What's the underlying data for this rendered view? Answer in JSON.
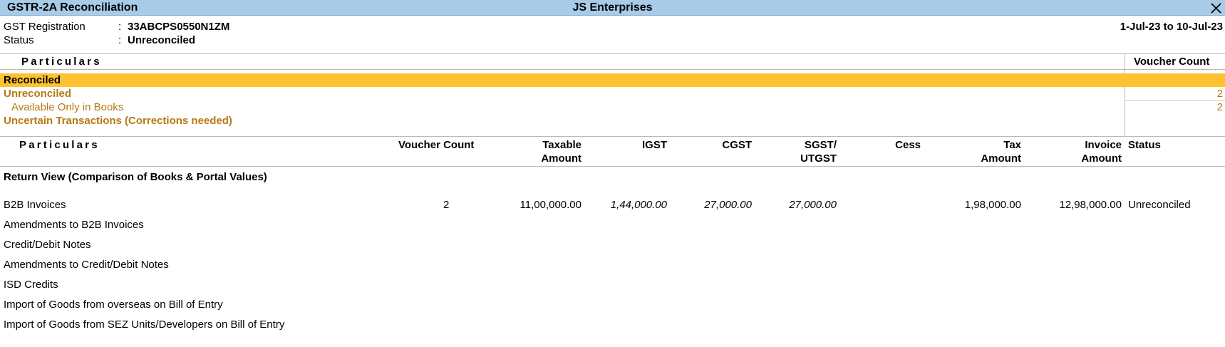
{
  "window": {
    "title": "GSTR-2A Reconciliation",
    "company": "JS Enterprises"
  },
  "info": {
    "gst_label": "GST Registration",
    "gst_value": "33ABCPS0550N1ZM",
    "status_label": "Status",
    "status_value": "Unreconciled",
    "colon": ":",
    "period": "1-Jul-23 to 10-Jul-23"
  },
  "summary": {
    "header_particulars": "Particulars",
    "header_voucher_count": "Voucher Count",
    "rows": [
      {
        "label": "Reconciled",
        "count": ""
      },
      {
        "label": "Unreconciled",
        "count": "2"
      },
      {
        "label": "Available Only in Books",
        "count": "2"
      },
      {
        "label": "Uncertain Transactions (Corrections needed)",
        "count": ""
      }
    ]
  },
  "detail": {
    "headers": {
      "particulars": "Particulars",
      "voucher_count": "Voucher Count",
      "taxable_1": "Taxable",
      "taxable_2": "Amount",
      "igst": "IGST",
      "cgst": "CGST",
      "sgst_1": "SGST/",
      "sgst_2": "UTGST",
      "cess": "Cess",
      "tax_1": "Tax",
      "tax_2": "Amount",
      "invoice_1": "Invoice",
      "invoice_2": "Amount",
      "status": "Status"
    },
    "section_title": "Return View (Comparison of Books & Portal Values)",
    "rows": [
      {
        "name": "B2B Invoices",
        "voucher_count": "2",
        "taxable": "11,00,000.00",
        "igst": "1,44,000.00",
        "cgst": "27,000.00",
        "sgst": "27,000.00",
        "cess": "",
        "tax": "1,98,000.00",
        "invoice": "12,98,000.00",
        "status": "Unreconciled"
      },
      {
        "name": "Amendments to B2B Invoices",
        "voucher_count": "",
        "taxable": "",
        "igst": "",
        "cgst": "",
        "sgst": "",
        "cess": "",
        "tax": "",
        "invoice": "",
        "status": ""
      },
      {
        "name": "Credit/Debit Notes",
        "voucher_count": "",
        "taxable": "",
        "igst": "",
        "cgst": "",
        "sgst": "",
        "cess": "",
        "tax": "",
        "invoice": "",
        "status": ""
      },
      {
        "name": "Amendments to Credit/Debit Notes",
        "voucher_count": "",
        "taxable": "",
        "igst": "",
        "cgst": "",
        "sgst": "",
        "cess": "",
        "tax": "",
        "invoice": "",
        "status": ""
      },
      {
        "name": "ISD Credits",
        "voucher_count": "",
        "taxable": "",
        "igst": "",
        "cgst": "",
        "sgst": "",
        "cess": "",
        "tax": "",
        "invoice": "",
        "status": ""
      },
      {
        "name": "Import of Goods from overseas on Bill of Entry",
        "voucher_count": "",
        "taxable": "",
        "igst": "",
        "cgst": "",
        "sgst": "",
        "cess": "",
        "tax": "",
        "invoice": "",
        "status": ""
      },
      {
        "name": "Import of Goods from SEZ Units/Developers on Bill of Entry",
        "voucher_count": "",
        "taxable": "",
        "igst": "",
        "cgst": "",
        "sgst": "",
        "cess": "",
        "tax": "",
        "invoice": "",
        "status": ""
      }
    ]
  },
  "colors": {
    "titlebar": "#a8cbe8",
    "selected_row": "#fdc22f",
    "accent_text": "#b57a12"
  },
  "icons": {
    "close": "close-icon"
  }
}
